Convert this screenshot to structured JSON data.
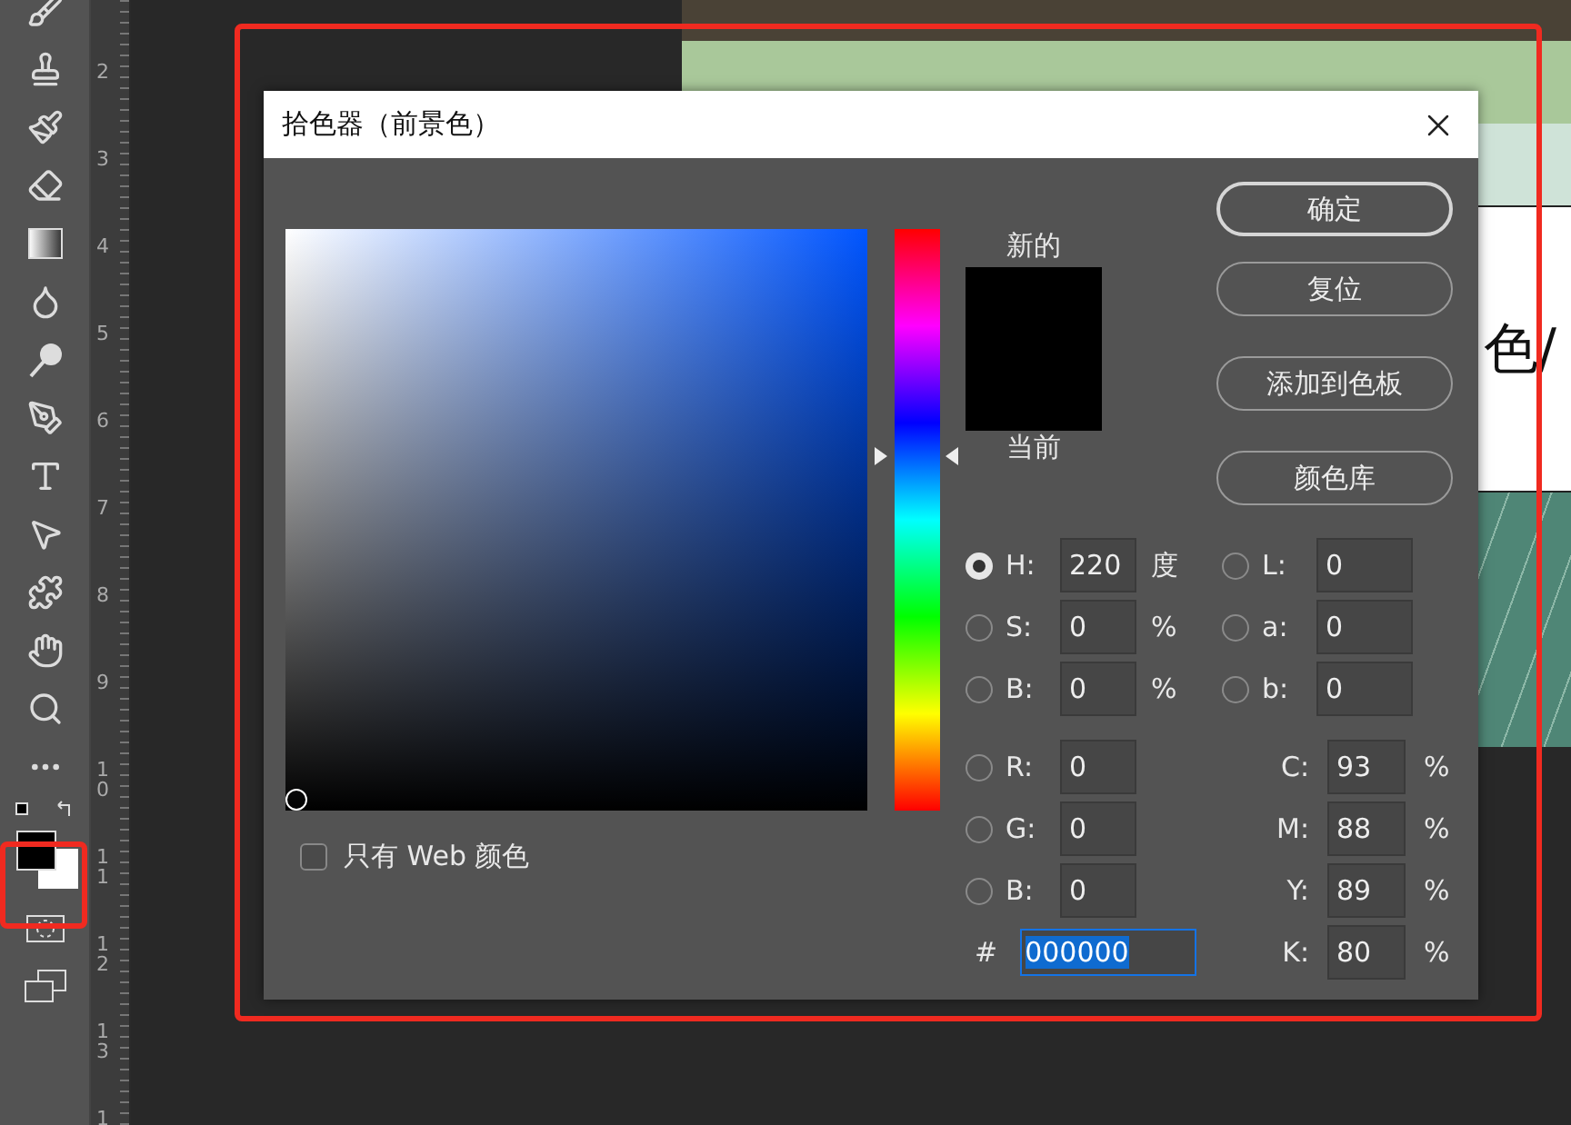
{
  "ruler": {
    "labels": [
      "2",
      "3",
      "4",
      "5",
      "6",
      "7",
      "8",
      "9",
      "10",
      "11",
      "12",
      "13",
      "1"
    ]
  },
  "canvas": {
    "banner_text": "色/"
  },
  "dialog": {
    "title": "拾色器（前景色）",
    "new_label": "新的",
    "current_label": "当前",
    "buttons": [
      {
        "label": "确定",
        "default": true
      },
      {
        "label": "复位",
        "default": false
      },
      {
        "label": "添加到色板",
        "default": false
      },
      {
        "label": "颜色库",
        "default": false
      }
    ],
    "hsb": [
      {
        "label": "H:",
        "value": "220",
        "unit": "度",
        "selected": true
      },
      {
        "label": "S:",
        "value": "0",
        "unit": "%",
        "selected": false
      },
      {
        "label": "B:",
        "value": "0",
        "unit": "%",
        "selected": false
      }
    ],
    "lab": [
      {
        "label": "L:",
        "value": "0",
        "selected": false
      },
      {
        "label": "a:",
        "value": "0",
        "selected": false
      },
      {
        "label": "b:",
        "value": "0",
        "selected": false
      }
    ],
    "rgb": [
      {
        "label": "R:",
        "value": "0",
        "selected": false
      },
      {
        "label": "G:",
        "value": "0",
        "selected": false
      },
      {
        "label": "B:",
        "value": "0",
        "selected": false
      }
    ],
    "cmyk": [
      {
        "label": "C:",
        "value": "93",
        "unit": "%"
      },
      {
        "label": "M:",
        "value": "88",
        "unit": "%"
      },
      {
        "label": "Y:",
        "value": "89",
        "unit": "%"
      },
      {
        "label": "K:",
        "value": "80",
        "unit": "%"
      }
    ],
    "hue_slider": {
      "level": 0.61
    },
    "hex": {
      "label": "#",
      "value": "000000",
      "text_selected": true
    },
    "web_only": {
      "label": "只有 Web 颜色",
      "checked": false
    }
  }
}
